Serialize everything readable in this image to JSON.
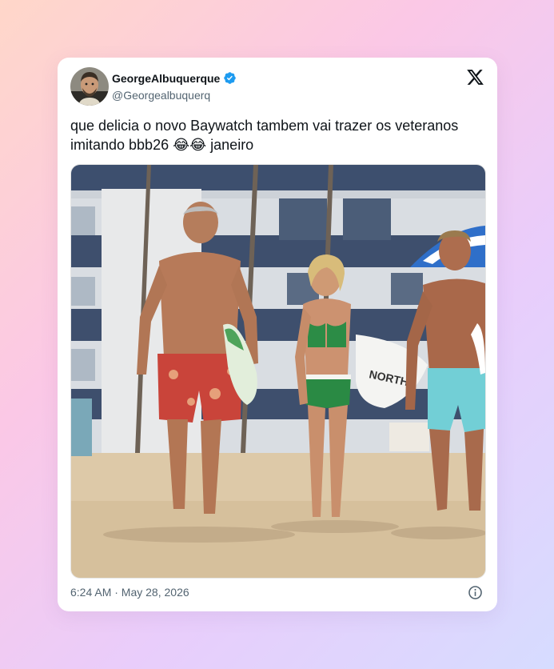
{
  "tweet": {
    "display_name": "GeorgeAlbuquerque",
    "handle": "@Georgealbuquerq",
    "text": "que delicia o novo Baywatch tambem vai trazer os veteranos imitando bbb26 😂😂 janeiro",
    "surfboard_text": "NORTH",
    "timestamp": "6:24 AM · May 28, 2026"
  },
  "icons": {
    "verified": "verified-badge-icon",
    "brand": "x-logo-icon",
    "info": "info-icon"
  },
  "colors": {
    "verified": "#1d9bf0",
    "text": "#0f1419",
    "muted": "#536471"
  }
}
